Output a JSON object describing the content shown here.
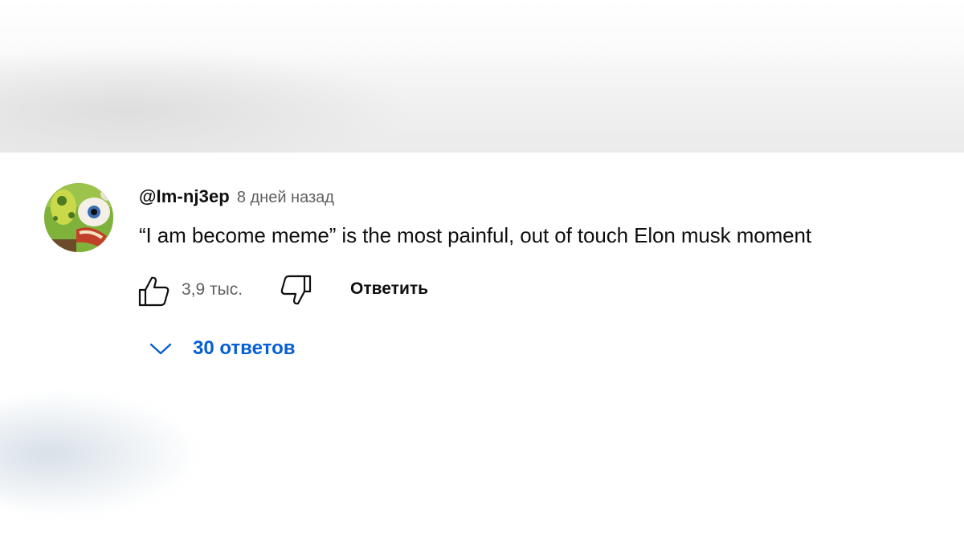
{
  "comment": {
    "author": "@Im-nj3ep",
    "time": "8 дней назад",
    "text": "“I am become meme” is the most painful, out of touch Elon musk moment",
    "likes": "3,9 тыс.",
    "reply_label": "Ответить",
    "replies_label": "30 ответов",
    "avatar_icon": "spongebob-avatar"
  },
  "icons": {
    "like": "thumbs-up-icon",
    "dislike": "thumbs-down-icon",
    "expand": "chevron-down-icon"
  },
  "colors": {
    "link_blue": "#065fd4",
    "text": "#0f0f0f",
    "secondary": "#606060"
  }
}
